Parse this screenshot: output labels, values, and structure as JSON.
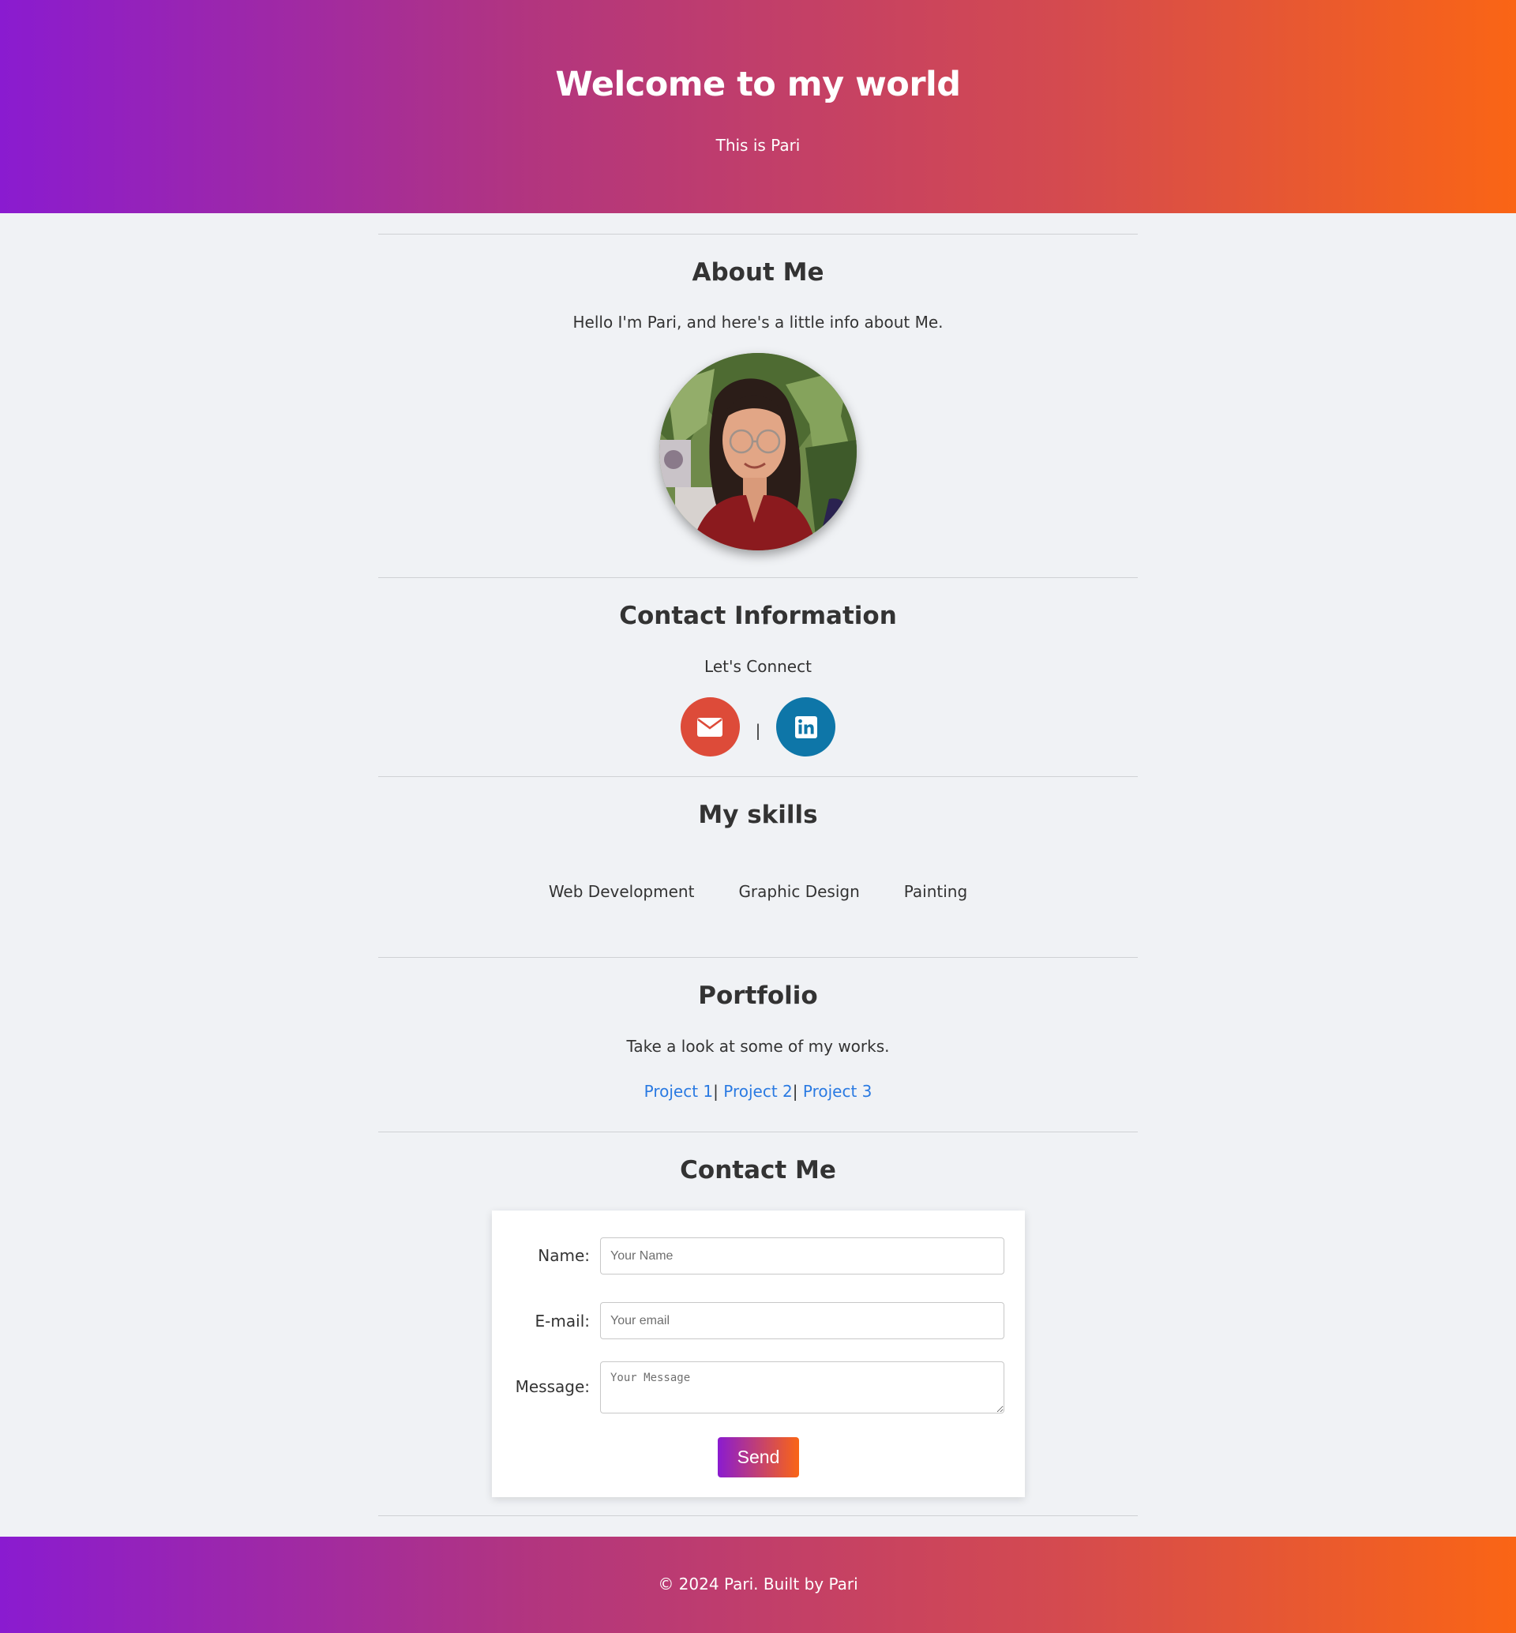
{
  "hero": {
    "title": "Welcome to my world",
    "subtitle": "This is Pari"
  },
  "about": {
    "heading": "About Me",
    "text": "Hello I'm Pari, and here's a little info about Me.",
    "photo_alt": "Pari"
  },
  "contact_info": {
    "heading": "Contact Information",
    "text": "Let's Connect",
    "separator": "|",
    "email_icon": "envelope-icon",
    "linkedin_icon": "linkedin-icon",
    "email_color": "#dd4b39",
    "linkedin_color": "#0e76a8"
  },
  "skills": {
    "heading": "My skills",
    "items": [
      "Web Development",
      "Graphic Design",
      "Painting"
    ]
  },
  "portfolio": {
    "heading": "Portfolio",
    "text": "Take a look at some of my works.",
    "projects": [
      "Project 1",
      "Project 2",
      "Project 3"
    ],
    "separator": "|",
    "link_color": "#2a7ae2"
  },
  "contact_me": {
    "heading": "Contact Me",
    "name_label": "Name:",
    "name_placeholder": "Your Name",
    "email_label": "E-mail:",
    "email_placeholder": "Your email",
    "message_label": "Message:",
    "message_placeholder": "Your Message",
    "send_label": "Send"
  },
  "footer": {
    "text": "© 2024 Pari. Built by Pari"
  },
  "colors": {
    "gradient_start": "#8a1bd0",
    "gradient_end": "#fa6515",
    "background": "#f0f2f5",
    "text": "#333333"
  }
}
